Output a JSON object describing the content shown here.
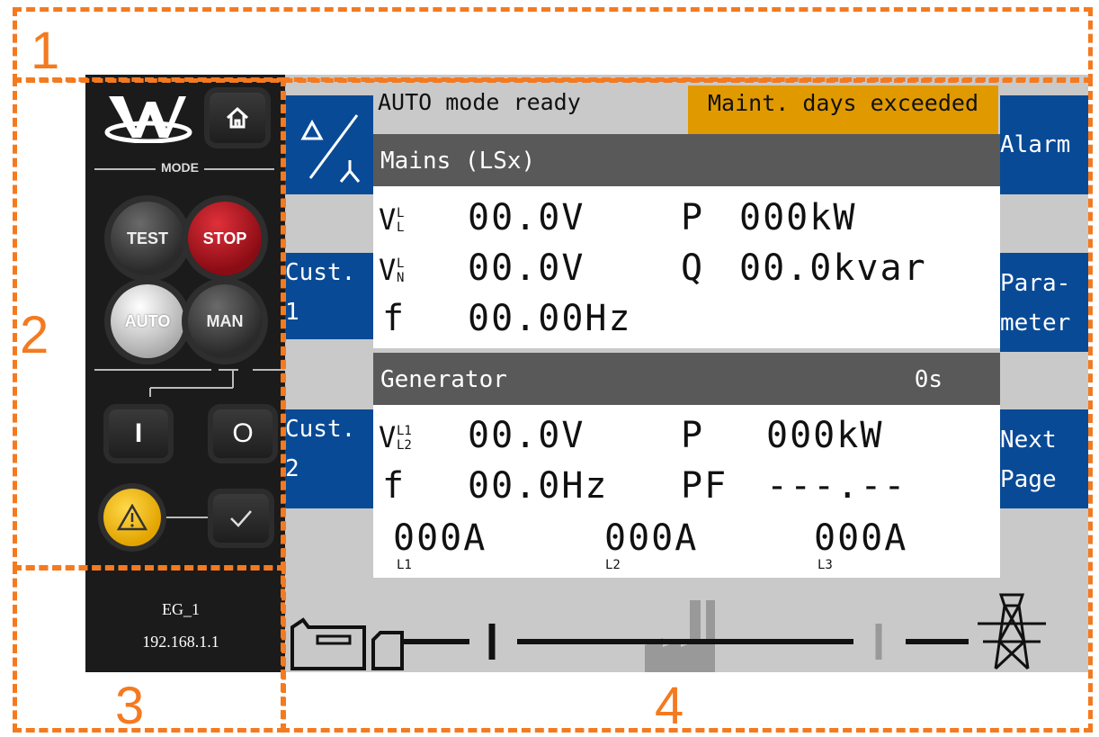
{
  "regions": [
    {
      "label": "1"
    },
    {
      "label": "2"
    },
    {
      "label": "3"
    },
    {
      "label": "4"
    }
  ],
  "panel": {
    "mode_label": "MODE",
    "buttons": {
      "test": "TEST",
      "stop": "STOP",
      "auto": "AUTO",
      "man": "MAN",
      "close": "I",
      "open": "O"
    },
    "device_name": "EG_1",
    "ip_address": "192.168.1.1"
  },
  "display": {
    "status_left": "AUTO mode ready",
    "status_right": "Maint. days exceeded",
    "side_left": {
      "cust1_line1": "Cust.",
      "cust1_line2": "1",
      "cust2_line1": "Cust.",
      "cust2_line2": "2"
    },
    "side_right": {
      "alarm": "Alarm",
      "param_line1": "Para-",
      "param_line2": "meter",
      "next_line1": "Next",
      "next_line2": "Page"
    },
    "mains": {
      "title": "Mains (LSx)",
      "row1_value": "00.0V",
      "row1_p_label": "P",
      "row1_p_value": "000kW",
      "row2_value": "00.0V",
      "row2_q_label": "Q",
      "row2_q_value": "00.0kvar",
      "row3_label": "f",
      "row3_value": "00.00Hz"
    },
    "generator": {
      "title": "Generator",
      "timer": "0s",
      "row1_value": "00.0V",
      "row1_p_label": "P",
      "row1_p_value": "000kW",
      "row2_label": "f",
      "row2_value": "00.0Hz",
      "row2_pf_label": "PF",
      "row2_pf_value": "---.--",
      "currents": [
        {
          "value": "000A",
          "phase": "L1"
        },
        {
          "value": "000A",
          "phase": "L2"
        },
        {
          "value": "000A",
          "phase": "L3"
        }
      ]
    }
  },
  "colors": {
    "annotation": "#f47a20",
    "side_button": "#084a96",
    "warning_bar": "#e09a00",
    "section_bar": "#595959"
  }
}
